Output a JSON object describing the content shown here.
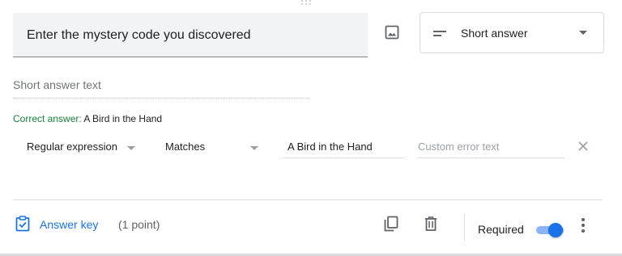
{
  "question": {
    "title": "Enter the mystery code you discovered",
    "type_label": "Short answer",
    "answer_placeholder": "Short answer text"
  },
  "correct_answer": {
    "label": "Correct answer:",
    "value": "A Bird in the Hand"
  },
  "validation": {
    "type": "Regular expression",
    "operator": "Matches",
    "pattern": "A Bird in the Hand",
    "error_placeholder": "Custom error text"
  },
  "footer": {
    "answer_key_label": "Answer key",
    "points": "(1 point)",
    "required_label": "Required",
    "required_on": true
  },
  "colors": {
    "accent": "#1a73e8",
    "correct_green": "#188038"
  },
  "icons": [
    "drag-handle-icon",
    "image-icon",
    "short-answer-icon",
    "chevron-down-icon",
    "close-icon",
    "answer-key-icon",
    "duplicate-icon",
    "delete-icon",
    "more-vert-icon"
  ]
}
